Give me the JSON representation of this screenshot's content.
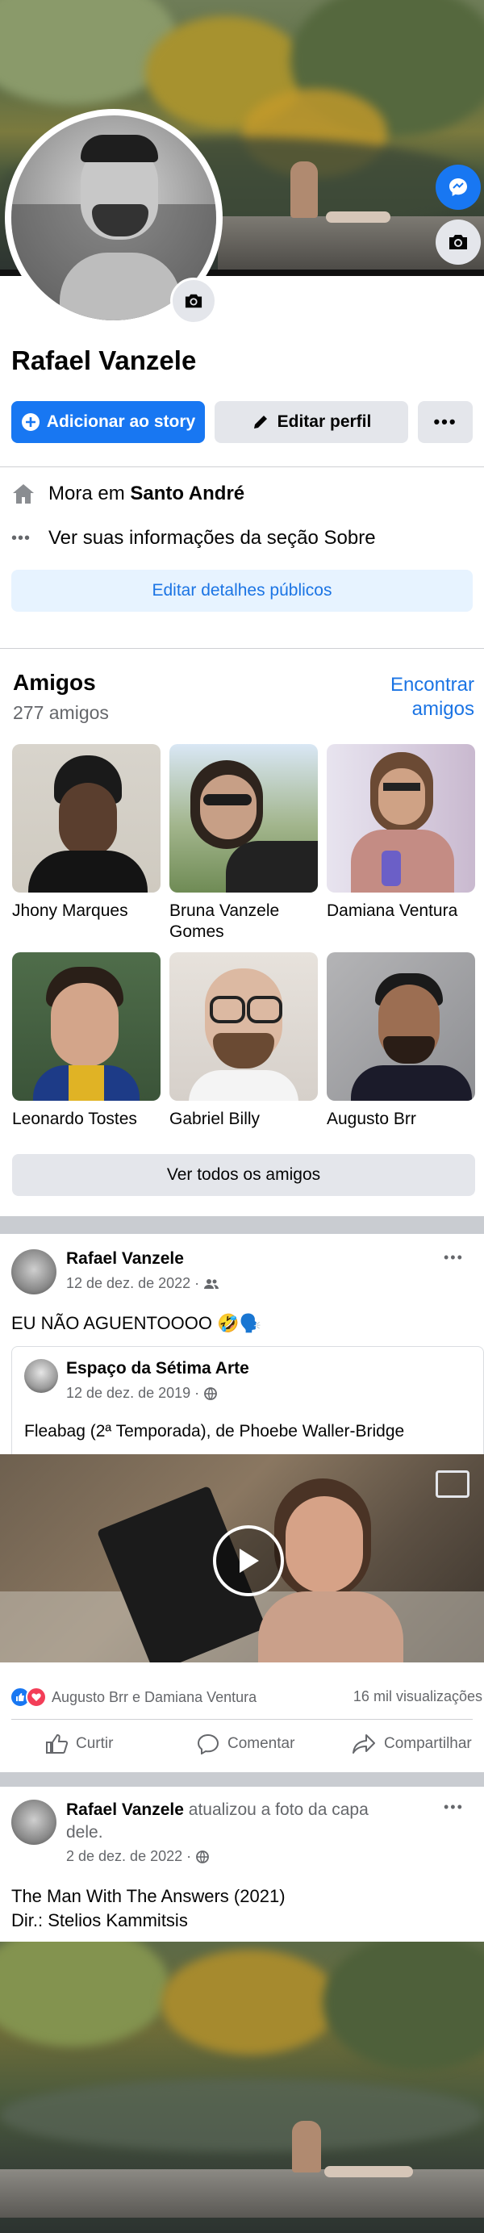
{
  "profile": {
    "name": "Rafael Vanzele",
    "buttons": {
      "story": "Adicionar ao story",
      "edit": "Editar perfil"
    },
    "lives_prefix": "Mora em",
    "lives_city": "Santo André",
    "about": "Ver suas informações da seção Sobre",
    "edit_details": "Editar detalhes públicos"
  },
  "friends": {
    "title": "Amigos",
    "count": "277 amigos",
    "find_line1": "Encontrar",
    "find_line2": "amigos",
    "items": [
      {
        "name": "Jhony Marques"
      },
      {
        "name": "Bruna Vanzele Gomes"
      },
      {
        "name": "Damiana Ventura"
      },
      {
        "name": "Leonardo Tostes"
      },
      {
        "name": "Gabriel Billy"
      },
      {
        "name": "Augusto Brr"
      }
    ],
    "see_all": "Ver todos os amigos"
  },
  "post1": {
    "author": "Rafael Vanzele",
    "date": "12 de dez. de 2022 ·",
    "text": "EU NÃO AGUENTOOOO 🤣🗣️",
    "shared": {
      "author": "Espaço da Sétima Arte",
      "date": "12 de dez. de 2019 ·",
      "text": "Fleabag (2ª Temporada), de Phoebe Waller-Bridge"
    },
    "reactions": "Augusto Brr e Damiana Ventura",
    "views": "16 mil visualizações",
    "actions": {
      "like": "Curtir",
      "comment": "Comentar",
      "share": "Compartilhar"
    }
  },
  "post2": {
    "author": "Rafael Vanzele",
    "action_line1": "atualizou a foto da capa",
    "action_line2": "dele.",
    "date": "2 de dez. de 2022 ·",
    "text_line1": "The Man With The Answers (2021)",
    "text_line2": "Dir.: Stelios Kammitsis"
  },
  "colors": {
    "accent": "#1877f2",
    "secondary_button": "#e4e6eb",
    "link": "#1b74e4",
    "muted": "#65676b",
    "divider": "#c9ccd1"
  }
}
